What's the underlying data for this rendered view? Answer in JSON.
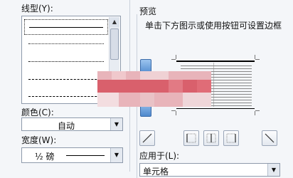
{
  "line_style": {
    "label": "线型(Y):",
    "items_count_visible": 5
  },
  "color": {
    "label": "颜色(C):",
    "value": "自动"
  },
  "width": {
    "label": "宽度(W):",
    "value": "½ 磅"
  },
  "preview": {
    "label": "预览",
    "hint": "单击下方图示或使用按钮可设置边框"
  },
  "apply_to": {
    "label": "应用于(L):",
    "value": "单元格"
  },
  "colors": {
    "accent": "#4e89cd",
    "blur_red": "#d9606c"
  }
}
